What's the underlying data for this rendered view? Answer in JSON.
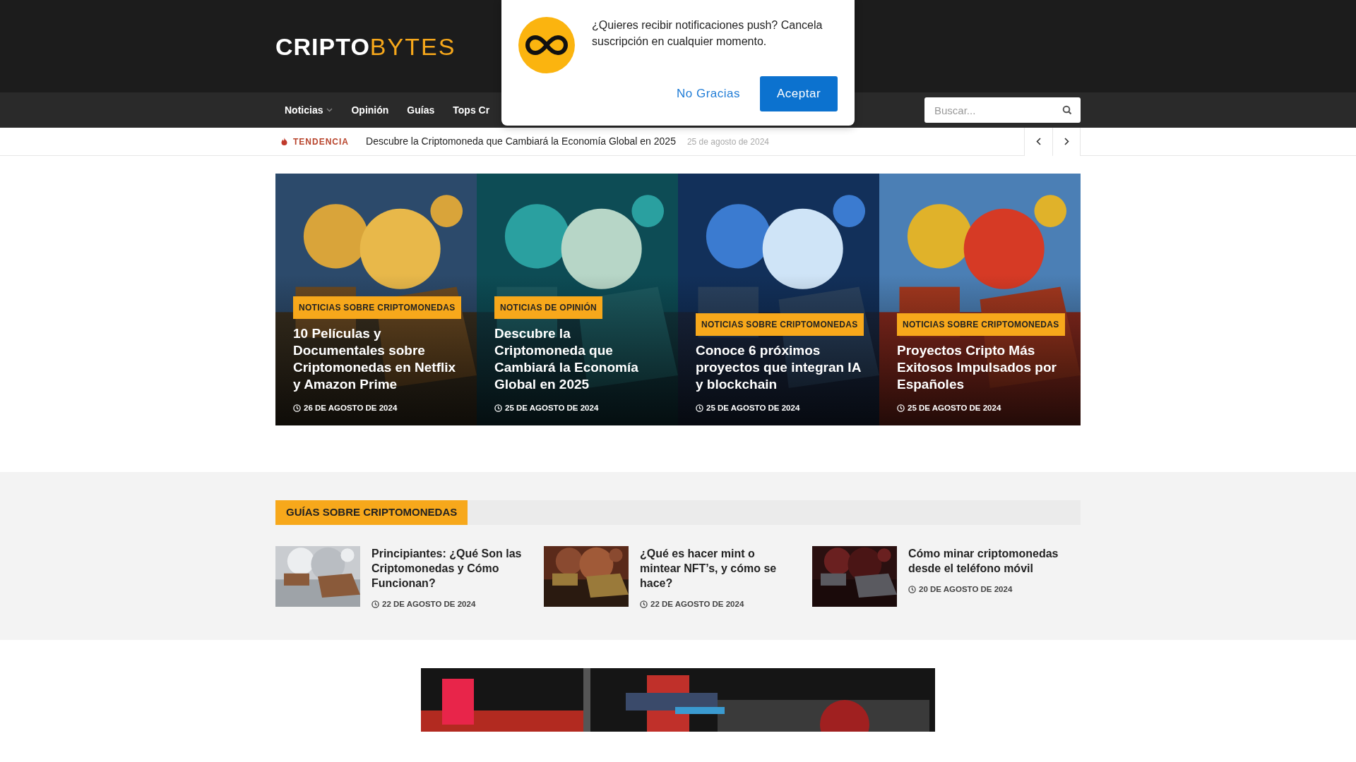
{
  "logo": {
    "text_a": "CRIPTO",
    "text_b": "BYTES"
  },
  "nav": [
    {
      "label": "Noticias",
      "dropdown": true
    },
    {
      "label": "Opinión",
      "dropdown": false
    },
    {
      "label": "Guías",
      "dropdown": false
    },
    {
      "label": "Tops Cr",
      "dropdown": false
    }
  ],
  "search": {
    "placeholder": "Buscar..."
  },
  "push_prompt": {
    "message": "¿Quieres recibir notificaciones push? Cancela suscripción en cualquier momento.",
    "buttons": [
      {
        "label": "No Gracias",
        "kind": "link"
      },
      {
        "label": "Aceptar",
        "kind": "primary"
      }
    ]
  },
  "trending": {
    "label": "TENDENCIA",
    "headline": "Descubre la Criptomoneda que Cambiará la Economía Global en 2025",
    "date": "25 de agosto de 2024"
  },
  "featured": [
    {
      "category": "NOTICIAS SOBRE CRIPTOMONEDAS",
      "title": "10 Películas y Documentales sobre Criptomonedas en Netflix y Amazon Prime",
      "date": "26 DE AGOSTO DE 2024"
    },
    {
      "category": "NOTICIAS DE OPINIÓN",
      "title": "Descubre la Criptomoneda que Cambiará la Economía Global en 2025",
      "date": "25 DE AGOSTO DE 2024"
    },
    {
      "category": "NOTICIAS SOBRE CRIPTOMONEDAS",
      "title": "Conoce 6 próximos proyectos que integran IA y blockchain",
      "date": "25 DE AGOSTO DE 2024"
    },
    {
      "category": "NOTICIAS SOBRE CRIPTOMONEDAS",
      "title": "Proyectos Cripto Más Exitosos Impulsados por Españoles",
      "date": "25 DE AGOSTO DE 2024"
    }
  ],
  "guides": {
    "heading": "GUÍAS SOBRE CRIPTOMONEDAS",
    "items": [
      {
        "title": "Principiantes: ¿Qué Son las Criptomonedas y Cómo Funcionan?",
        "date": "22 DE AGOSTO DE 2024"
      },
      {
        "title": "¿Qué es hacer mint o mintear NFT’s, y cómo se hace?",
        "date": "22 DE AGOSTO DE 2024"
      },
      {
        "title": "Cómo minar criptomonedas desde el teléfono móvil",
        "date": "20 DE AGOSTO DE 2024"
      }
    ]
  }
}
